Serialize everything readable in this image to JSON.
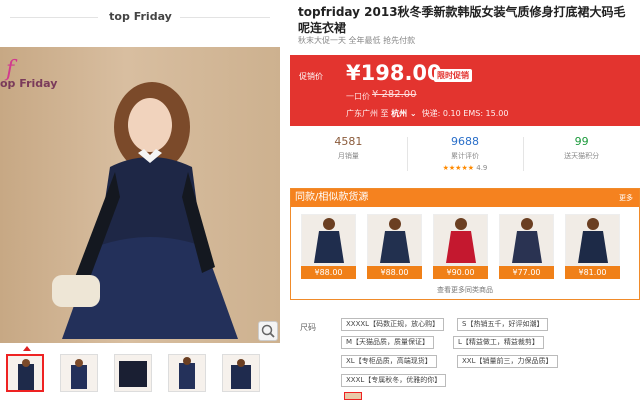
{
  "shop": {
    "name": "top Friday",
    "logo_text": "op Friday",
    "logo_mark": "f"
  },
  "product": {
    "title": "topfriday 2013秋冬季新款韩版女装气质修身打底裙大码毛呢连衣裙",
    "subtitle": "秋末大促一天 全年最低 抢先付款"
  },
  "price": {
    "label": "促销价",
    "current": "¥198.00",
    "badge": "限时促销",
    "original_label": "一口价",
    "original": "¥ 282.00",
    "shipping_from": "广东广州 至",
    "shipping_to": "杭州",
    "shipping_fees": "快递: 0.10 EMS: 15.00"
  },
  "stats": [
    {
      "value": "4581",
      "caption": "月销量",
      "color": "brown"
    },
    {
      "value": "9688",
      "caption": "累计评价",
      "rating": "4.9",
      "stars": "★★★★★",
      "color": "blue"
    },
    {
      "value": "99",
      "caption": "送天猫积分",
      "color": "green"
    }
  ],
  "similar": {
    "title": "同款/相似款货源",
    "more": "更多",
    "items": [
      {
        "price": "¥88.00",
        "color": "#1f2d4d"
      },
      {
        "price": "¥88.00",
        "color": "#22304f"
      },
      {
        "price": "¥90.00",
        "color": "#c4182f"
      },
      {
        "price": "¥77.00",
        "color": "#2a3352"
      },
      {
        "price": "¥81.00",
        "color": "#1d2a47"
      }
    ],
    "view_all": "查看更多同类商品"
  },
  "sizes": {
    "label": "尺码",
    "options": [
      "XXXXL【码数正规，放心购】",
      "S【热销五千，好评如潮】",
      "M【天猫品质，质量保证】",
      "L【精益做工，精益裁剪】",
      "XL【专柜品质，高端现货】",
      "XXL【销量前三，力保品质】",
      "XXXL【专属秋冬，优雅的你】"
    ]
  },
  "thumbnail_count": 5
}
